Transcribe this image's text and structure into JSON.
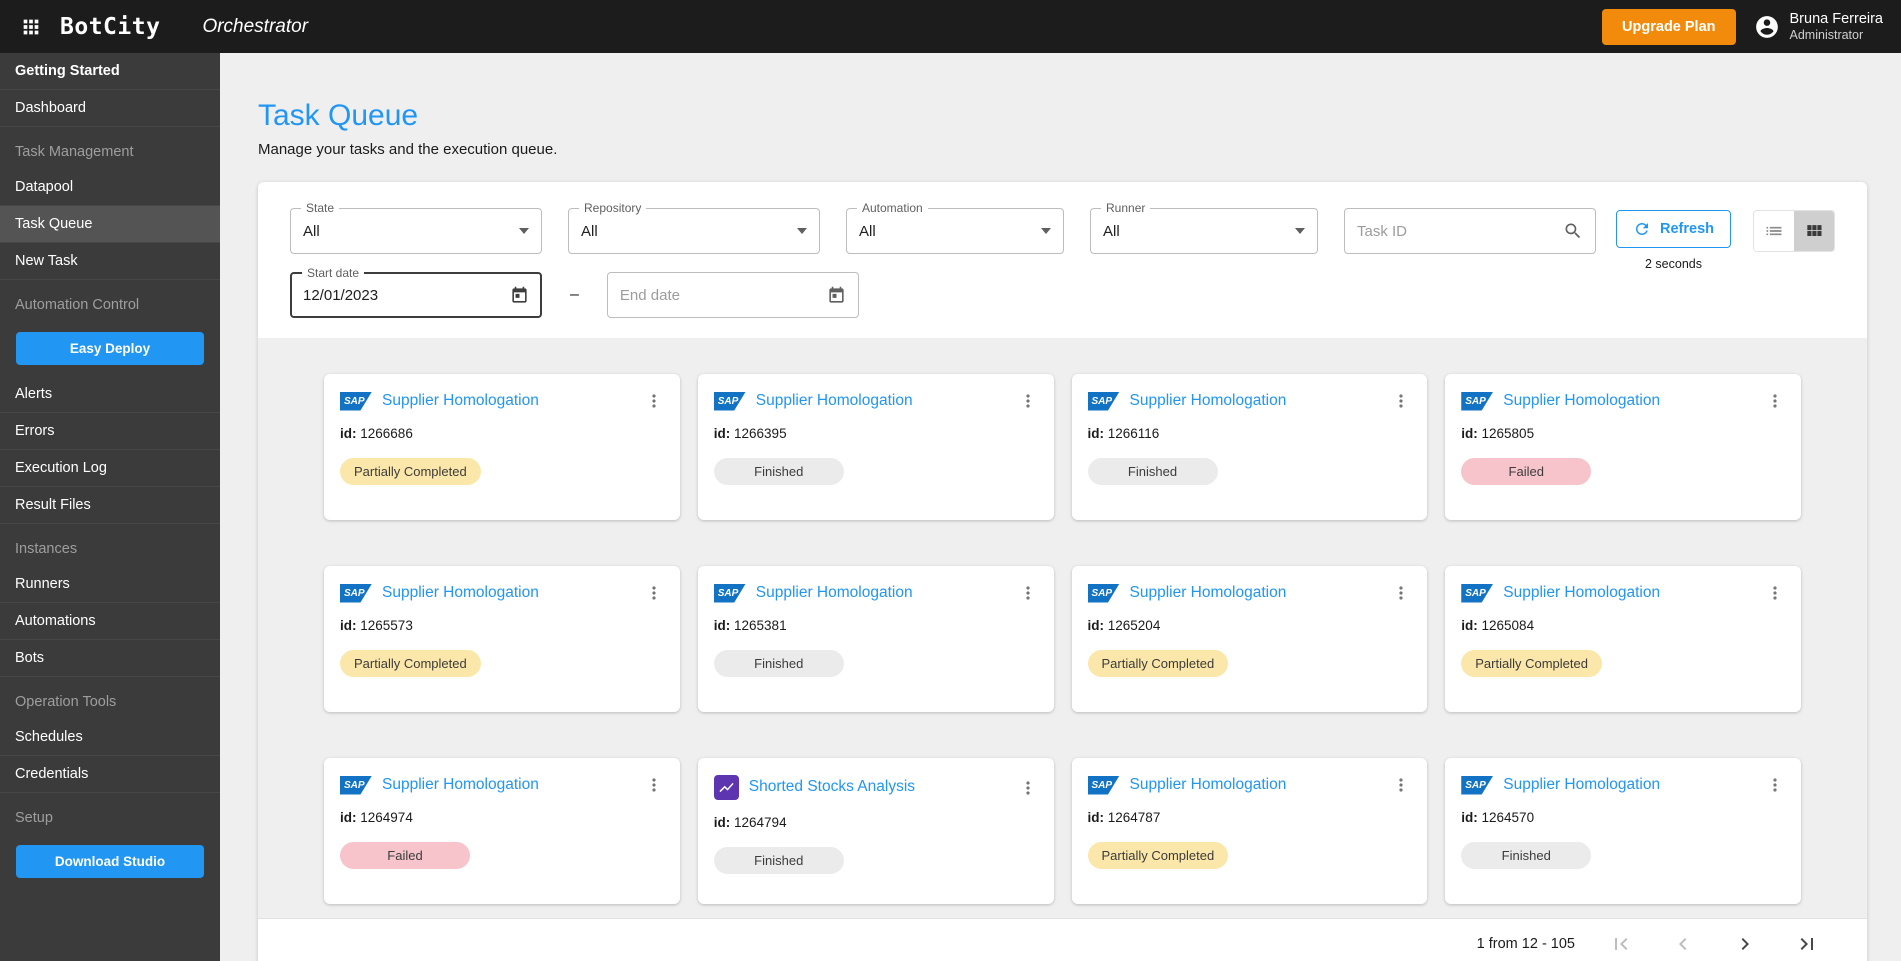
{
  "topbar": {
    "logo": "BotCity",
    "product": "Orchestrator",
    "upgrade_label": "Upgrade Plan",
    "user_name": "Bruna Ferreira",
    "user_role": "Administrator"
  },
  "sidebar": {
    "items": [
      {
        "type": "link",
        "label": "Getting Started",
        "bold": true
      },
      {
        "type": "link",
        "label": "Dashboard"
      },
      {
        "type": "header",
        "label": "Task Management"
      },
      {
        "type": "link",
        "label": "Datapool"
      },
      {
        "type": "link",
        "label": "Task Queue",
        "selected": true
      },
      {
        "type": "link",
        "label": "New Task"
      },
      {
        "type": "header",
        "label": "Automation Control"
      },
      {
        "type": "button",
        "label": "Easy Deploy"
      },
      {
        "type": "link",
        "label": "Alerts"
      },
      {
        "type": "link",
        "label": "Errors"
      },
      {
        "type": "link",
        "label": "Execution Log"
      },
      {
        "type": "link",
        "label": "Result Files"
      },
      {
        "type": "header",
        "label": "Instances"
      },
      {
        "type": "link",
        "label": "Runners"
      },
      {
        "type": "link",
        "label": "Automations"
      },
      {
        "type": "link",
        "label": "Bots"
      },
      {
        "type": "header",
        "label": "Operation Tools"
      },
      {
        "type": "link",
        "label": "Schedules"
      },
      {
        "type": "link",
        "label": "Credentials"
      },
      {
        "type": "header",
        "label": "Setup"
      },
      {
        "type": "button",
        "label": "Download Studio"
      }
    ]
  },
  "page": {
    "title": "Task Queue",
    "subtitle": "Manage your tasks and the execution queue."
  },
  "filters": {
    "state": {
      "label": "State",
      "value": "All"
    },
    "repository": {
      "label": "Repository",
      "value": "All"
    },
    "automation": {
      "label": "Automation",
      "value": "All"
    },
    "runner": {
      "label": "Runner",
      "value": "All"
    },
    "task_id_placeholder": "Task ID",
    "refresh_label": "Refresh",
    "refresh_interval": "2 seconds",
    "start_date": {
      "label": "Start date",
      "value": "12/01/2023"
    },
    "end_date": {
      "placeholder": "End date"
    },
    "date_separator": "–"
  },
  "icons": {
    "sap_text": "SAP"
  },
  "cards": [
    {
      "icon": "sap-icon",
      "title": "Supplier Homologation",
      "id_label": "id:",
      "id": "1266686",
      "status": "Partially Completed"
    },
    {
      "icon": "sap-icon",
      "title": "Supplier Homologation",
      "id_label": "id:",
      "id": "1266395",
      "status": "Finished"
    },
    {
      "icon": "sap-icon",
      "title": "Supplier Homologation",
      "id_label": "id:",
      "id": "1266116",
      "status": "Finished"
    },
    {
      "icon": "sap-icon",
      "title": "Supplier Homologation",
      "id_label": "id:",
      "id": "1265805",
      "status": "Failed"
    },
    {
      "icon": "sap-icon",
      "title": "Supplier Homologation",
      "id_label": "id:",
      "id": "1265573",
      "status": "Partially Completed"
    },
    {
      "icon": "sap-icon",
      "title": "Supplier Homologation",
      "id_label": "id:",
      "id": "1265381",
      "status": "Finished"
    },
    {
      "icon": "sap-icon",
      "title": "Supplier Homologation",
      "id_label": "id:",
      "id": "1265204",
      "status": "Partially Completed"
    },
    {
      "icon": "sap-icon",
      "title": "Supplier Homologation",
      "id_label": "id:",
      "id": "1265084",
      "status": "Partially Completed"
    },
    {
      "icon": "sap-icon",
      "title": "Supplier Homologation",
      "id_label": "id:",
      "id": "1264974",
      "status": "Failed"
    },
    {
      "icon": "stocks-icon",
      "title": "Shorted Stocks Analysis",
      "id_label": "id:",
      "id": "1264794",
      "status": "Finished"
    },
    {
      "icon": "sap-icon",
      "title": "Supplier Homologation",
      "id_label": "id:",
      "id": "1264787",
      "status": "Partially Completed"
    },
    {
      "icon": "sap-icon",
      "title": "Supplier Homologation",
      "id_label": "id:",
      "id": "1264570",
      "status": "Finished"
    }
  ],
  "pagination": {
    "label": "1 from 12 - 105"
  },
  "colors": {
    "accent_blue": "#2196F3",
    "upgrade_orange": "#F28B0C",
    "badge_partial_bg": "#FBE7A9",
    "badge_finished_bg": "#EBEBEB",
    "badge_failed_bg": "#F6C4CA"
  }
}
